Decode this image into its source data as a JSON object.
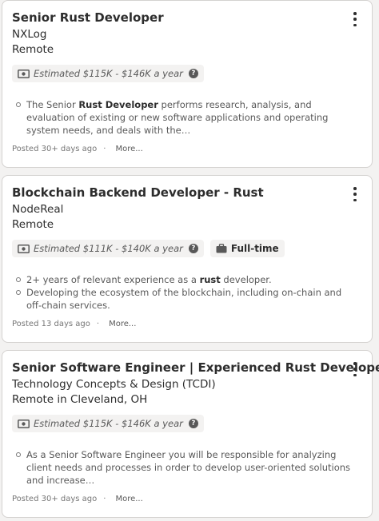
{
  "jobs": [
    {
      "title": "Senior Rust Developer",
      "company": "NXLog",
      "location": "Remote",
      "salary": "Estimated $115K - $146K a year",
      "job_type": "",
      "snippet": [
        [
          "The Senior ",
          "Rust Developer",
          " performs research, analysis, and evaluation of existing or new software applications and operating system needs, and deals with the…"
        ]
      ],
      "posted": "Posted 30+ days ago",
      "separator": "·",
      "more": "More..."
    },
    {
      "title": "Blockchain Backend Developer - Rust",
      "company": "NodeReal",
      "location": "Remote",
      "salary": "Estimated $111K - $140K a year",
      "job_type": "Full-time",
      "snippet": [
        [
          "2+ years of relevant experience as a ",
          "rust",
          " developer."
        ],
        [
          "Developing the ecosystem of the blockchain, including on-chain and off-chain services.",
          "",
          ""
        ]
      ],
      "posted": "Posted 13 days ago",
      "separator": "·",
      "more": "More..."
    },
    {
      "title": "Senior Software Engineer | Experienced Rust Developer",
      "company": "Technology Concepts & Design (TCDI)",
      "location": "Remote in Cleveland, OH",
      "salary": "Estimated $115K - $146K a year",
      "job_type": "",
      "snippet": [
        [
          "As a Senior Software Engineer you will be responsible for analyzing client needs and processes in order to develop user-oriented solutions and increase…",
          "",
          ""
        ]
      ],
      "posted": "Posted 30+ days ago",
      "separator": "·",
      "more": "More..."
    }
  ],
  "icons": {
    "salary": "money-icon",
    "help": "help-icon",
    "job_type": "briefcase-icon",
    "menu": "more-options-icon"
  },
  "colors": {
    "text": "#2d2d2d",
    "muted": "#595959",
    "chip_bg": "#f3f2f1",
    "border": "#d4d2d0"
  }
}
